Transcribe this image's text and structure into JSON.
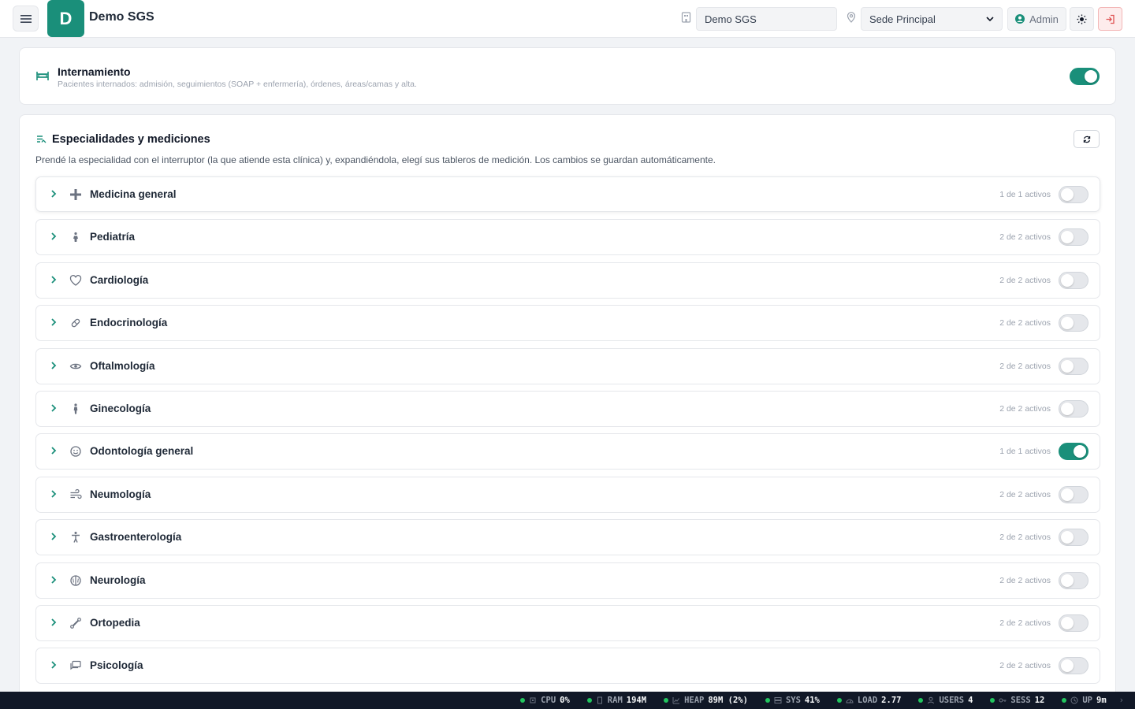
{
  "header": {
    "logo_letter": "D",
    "app_title": "Demo SGS",
    "org_value": "Demo SGS",
    "sede_value": "Sede Principal",
    "admin_label": "Admin"
  },
  "internamiento": {
    "title": "Internamiento",
    "description": "Pacientes internados: admisión, seguimientos (SOAP + enfermería), órdenes, áreas/camas y alta.",
    "enabled": true
  },
  "especialidades": {
    "title": "Especialidades y mediciones",
    "description": "Prendé la especialidad con el interruptor (la que atiende esta clínica) y, expandiéndola, elegí sus tableros de medición. Los cambios se guardan automáticamente.",
    "items": [
      {
        "name": "Medicina general",
        "count": "1 de 1 activos",
        "icon": "plus-icon",
        "enabled": false
      },
      {
        "name": "Pediatría",
        "count": "2 de 2 activos",
        "icon": "child-icon",
        "enabled": false
      },
      {
        "name": "Cardiología",
        "count": "2 de 2 activos",
        "icon": "heart-icon",
        "enabled": false
      },
      {
        "name": "Endocrinología",
        "count": "2 de 2 activos",
        "icon": "pill-icon",
        "enabled": false
      },
      {
        "name": "Oftalmología",
        "count": "2 de 2 activos",
        "icon": "eye-icon",
        "enabled": false
      },
      {
        "name": "Ginecología",
        "count": "2 de 2 activos",
        "icon": "woman-icon",
        "enabled": false
      },
      {
        "name": "Odontología general",
        "count": "1 de 1 activos",
        "icon": "smile-icon",
        "enabled": true
      },
      {
        "name": "Neumología",
        "count": "2 de 2 activos",
        "icon": "wind-icon",
        "enabled": false
      },
      {
        "name": "Gastroenterología",
        "count": "2 de 2 activos",
        "icon": "body-icon",
        "enabled": false
      },
      {
        "name": "Neurología",
        "count": "2 de 2 activos",
        "icon": "brain-icon",
        "enabled": false
      },
      {
        "name": "Ortopedia",
        "count": "2 de 2 activos",
        "icon": "bone-icon",
        "enabled": false
      },
      {
        "name": "Psicología",
        "count": "2 de 2 activos",
        "icon": "chat-icon",
        "enabled": false
      }
    ]
  },
  "statusbar": [
    {
      "label": "CPU",
      "value": "0%",
      "icon": "cpu-icon"
    },
    {
      "label": "RAM",
      "value": "194M",
      "icon": "memory-icon"
    },
    {
      "label": "HEAP",
      "value": "89M (2%)",
      "icon": "chart-icon"
    },
    {
      "label": "SYS",
      "value": "41%",
      "icon": "server-icon"
    },
    {
      "label": "LOAD",
      "value": "2.77",
      "icon": "gauge-icon"
    },
    {
      "label": "USERS",
      "value": "4",
      "icon": "user-icon"
    },
    {
      "label": "SESS",
      "value": "12",
      "icon": "key-icon"
    },
    {
      "label": "UP",
      "value": "9m",
      "icon": "clock-icon"
    }
  ],
  "colors": {
    "accent": "#1a8f7a",
    "status_ok": "#22c55e",
    "logout": "#e05252"
  }
}
